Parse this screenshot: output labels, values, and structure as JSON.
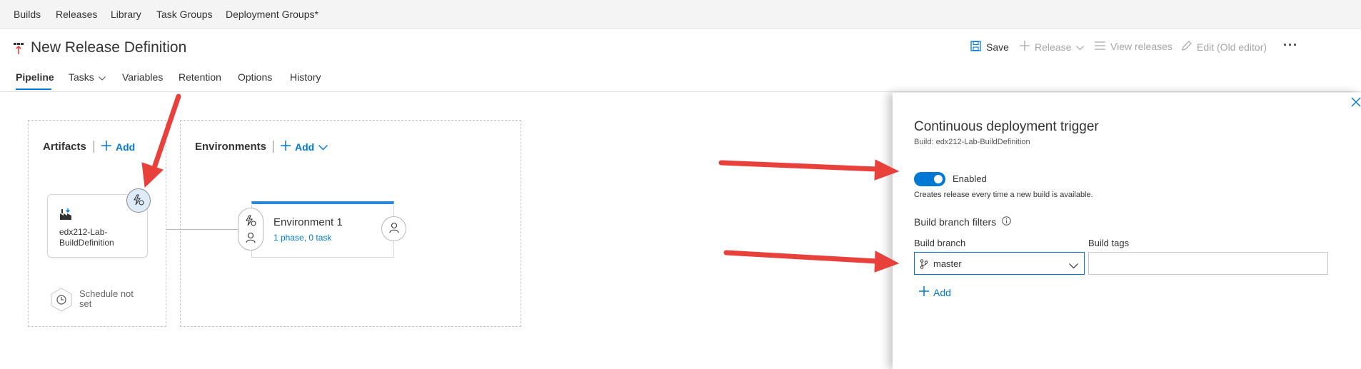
{
  "hub_bar": {
    "items": [
      "Builds",
      "Releases",
      "Library",
      "Task Groups",
      "Deployment Groups*"
    ]
  },
  "header": {
    "title": "New Release Definition",
    "commands": {
      "save": "Save",
      "release": "Release",
      "view_releases": "View releases",
      "edit_old": "Edit (Old editor)",
      "more": "···"
    }
  },
  "tabs": {
    "pipeline": "Pipeline",
    "tasks": "Tasks",
    "variables": "Variables",
    "retention": "Retention",
    "options": "Options",
    "history": "History",
    "active": "Pipeline"
  },
  "artifacts": {
    "title": "Artifacts",
    "add": "Add",
    "artifact_name": "edx212-Lab-BuildDefinition",
    "schedule": "Schedule not set"
  },
  "environments": {
    "title": "Environments",
    "add": "Add",
    "environment_name": "Environment 1",
    "environment_summary": "1 phase, 0 task"
  },
  "panel": {
    "title": "Continuous deployment trigger",
    "subtitle": "Build: edx212-Lab-BuildDefinition",
    "toggle_label": "Enabled",
    "toggle_on": true,
    "toggle_description": "Creates release every time a new build is available.",
    "filters_title": "Build branch filters",
    "branch_label": "Build branch",
    "branch_value": "master",
    "tags_label": "Build tags",
    "tags_value": "",
    "add": "Add"
  },
  "colors": {
    "accent": "#0078d4",
    "annotation_arrow": "#e8413b",
    "environment_bar": "#2b88d8",
    "trigger_bg": "#deecf9"
  },
  "icons": {
    "title": "release-pipeline-icon",
    "save": "floppy-disk-icon",
    "release": "plus-icon",
    "view_releases": "list-icon",
    "edit": "pencil-icon",
    "artifact": "build-factory-icon",
    "trigger": "lightning-trigger-icon",
    "schedule": "clock-icon",
    "approver": "person-icon",
    "branch": "git-branch-icon",
    "info": "info-icon",
    "close": "close-icon"
  }
}
